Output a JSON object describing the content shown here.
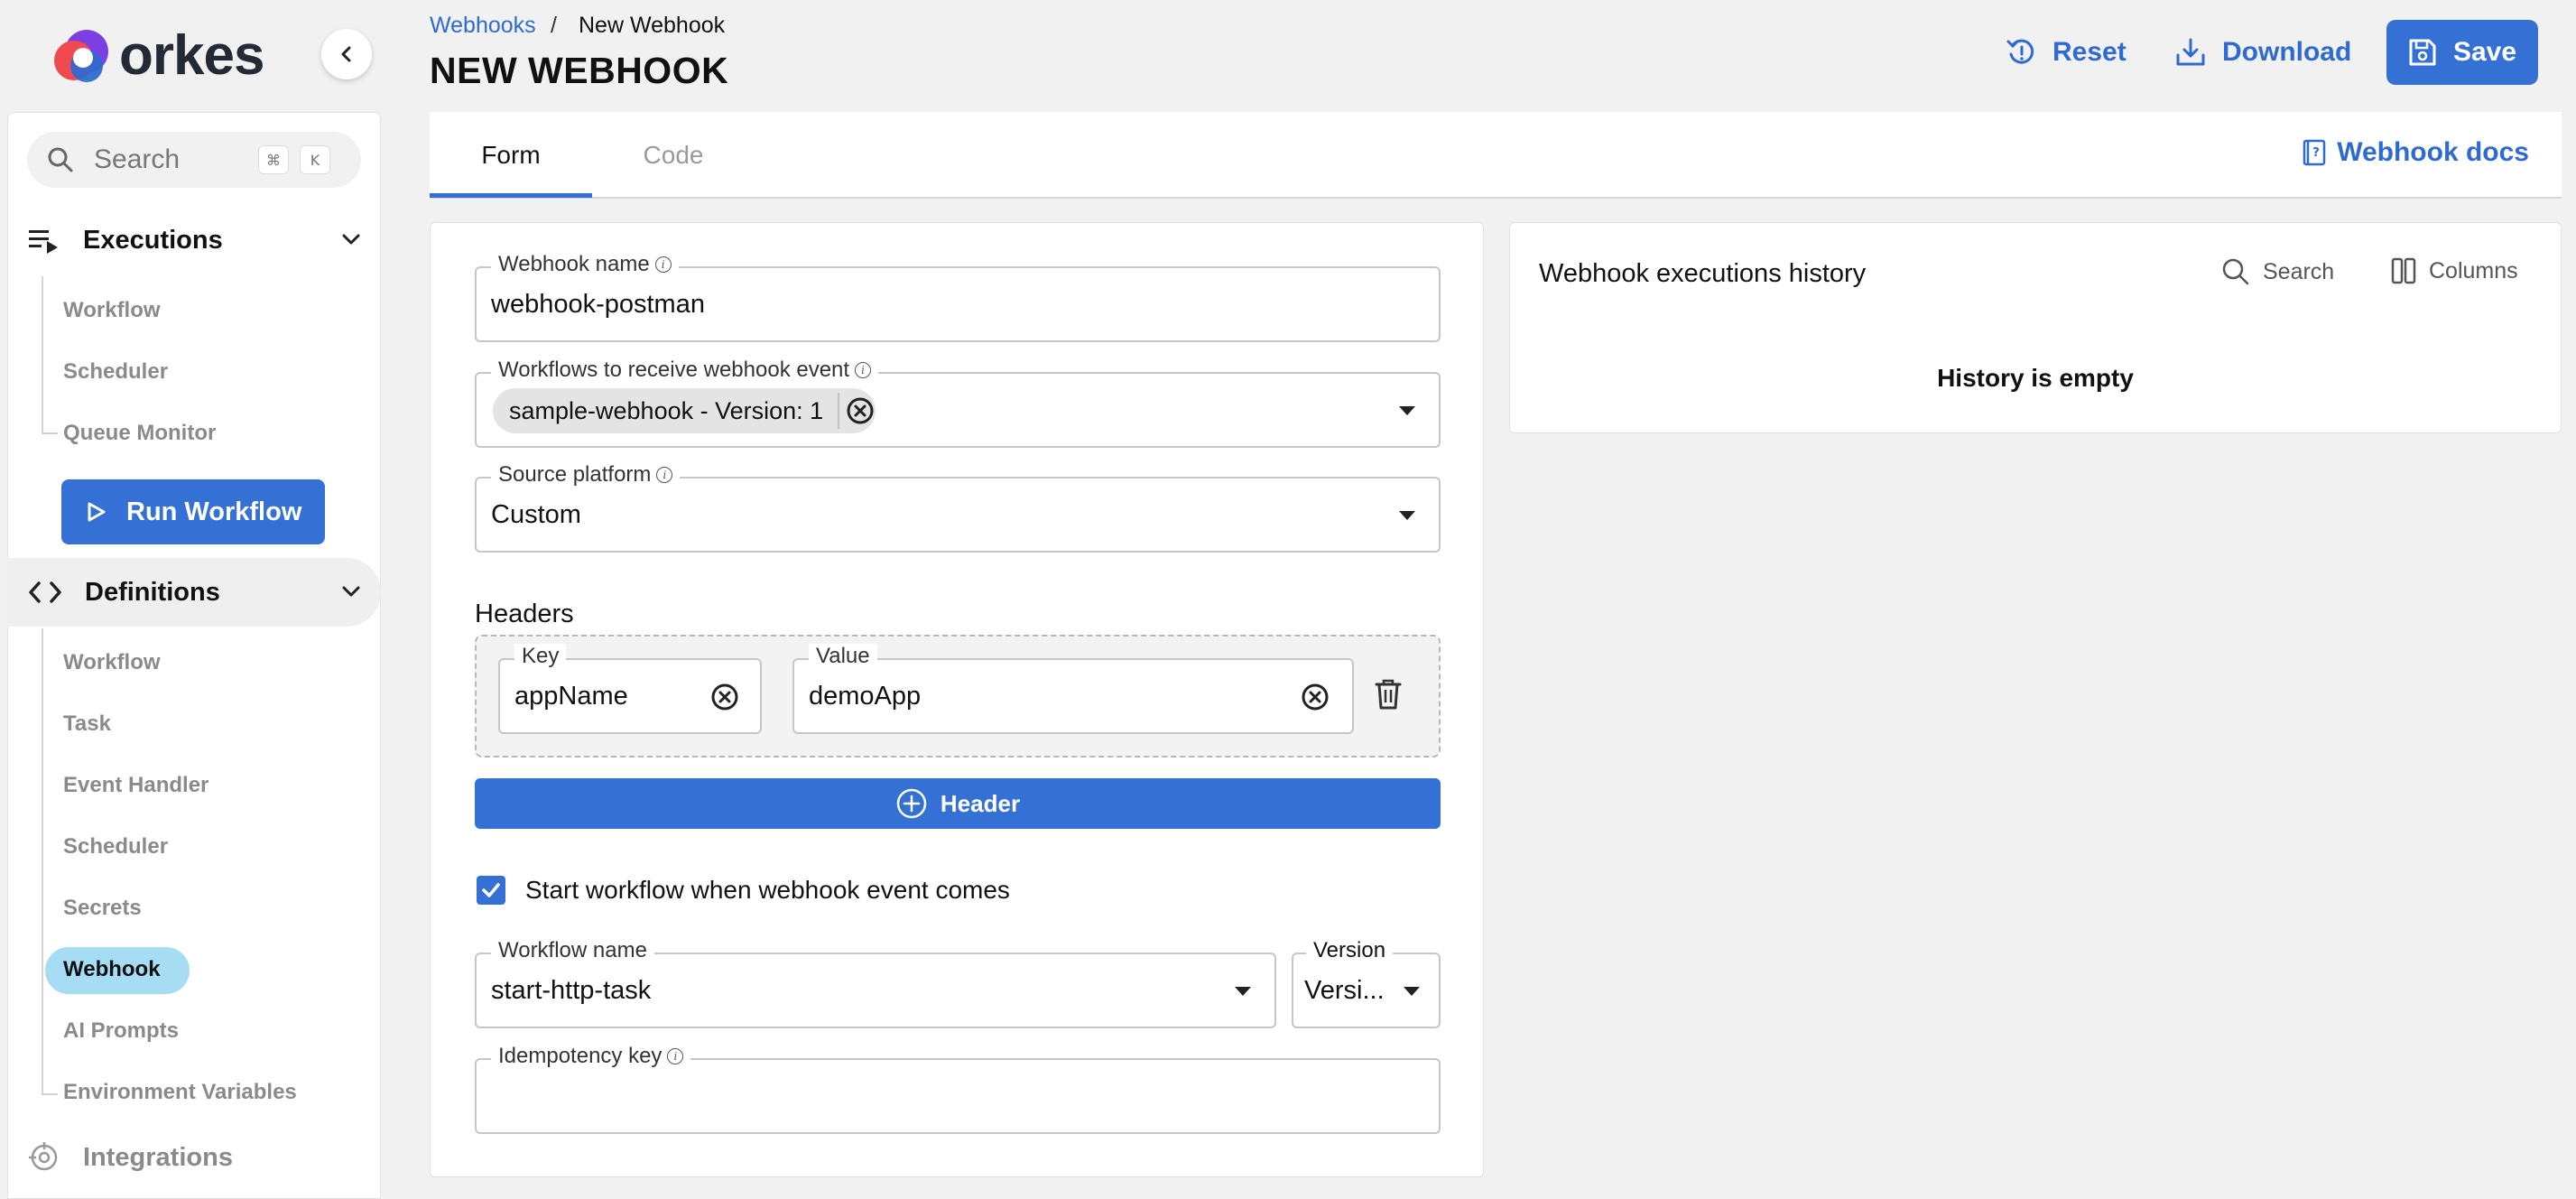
{
  "brand": {
    "name": "orkes",
    "accent": "#3571d4",
    "active_pill": "#a6dcf4"
  },
  "sidebar": {
    "search": {
      "placeholder": "Search",
      "shortcut_keys": [
        "⌘",
        "K"
      ]
    },
    "sections": [
      {
        "label": "Executions",
        "icon": "executions-icon",
        "items": [
          "Workflow",
          "Scheduler",
          "Queue Monitor"
        ]
      },
      {
        "label": "Definitions",
        "icon": "code-brackets-icon",
        "items": [
          "Workflow",
          "Task",
          "Event Handler",
          "Scheduler",
          "Secrets",
          "Webhook",
          "AI Prompts",
          "Environment Variables"
        ],
        "active_item": "Webhook"
      },
      {
        "label": "Integrations",
        "icon": "integrations-icon",
        "items": []
      }
    ],
    "run_workflow_label": "Run Workflow"
  },
  "header": {
    "breadcrumb": {
      "parent": "Webhooks",
      "separator": "/",
      "current": "New Webhook"
    },
    "title": "NEW WEBHOOK",
    "actions": {
      "reset": "Reset",
      "download": "Download",
      "save": "Save"
    }
  },
  "tabs": {
    "items": [
      "Form",
      "Code"
    ],
    "active": "Form",
    "docs_link": "Webhook docs"
  },
  "form": {
    "webhook_name": {
      "label": "Webhook name",
      "value": "webhook-postman"
    },
    "workflows": {
      "label": "Workflows to receive webhook event",
      "chips": [
        "sample-webhook - Version: 1"
      ]
    },
    "source_platform": {
      "label": "Source platform",
      "value": "Custom"
    },
    "headers": {
      "label": "Headers",
      "rows": [
        {
          "key_label": "Key",
          "key": "appName",
          "value_label": "Value",
          "value": "demoApp"
        }
      ],
      "add_label": "Header"
    },
    "start_workflow": {
      "checked": true,
      "label": "Start workflow when webhook event comes"
    },
    "workflow_name": {
      "label": "Workflow name",
      "value": "start-http-task"
    },
    "version": {
      "label": "Version",
      "value": "Versi..."
    },
    "idempotency_key": {
      "label": "Idempotency key",
      "value": ""
    }
  },
  "history": {
    "title": "Webhook executions history",
    "search_label": "Search",
    "columns_label": "Columns",
    "empty_text": "History is empty"
  }
}
